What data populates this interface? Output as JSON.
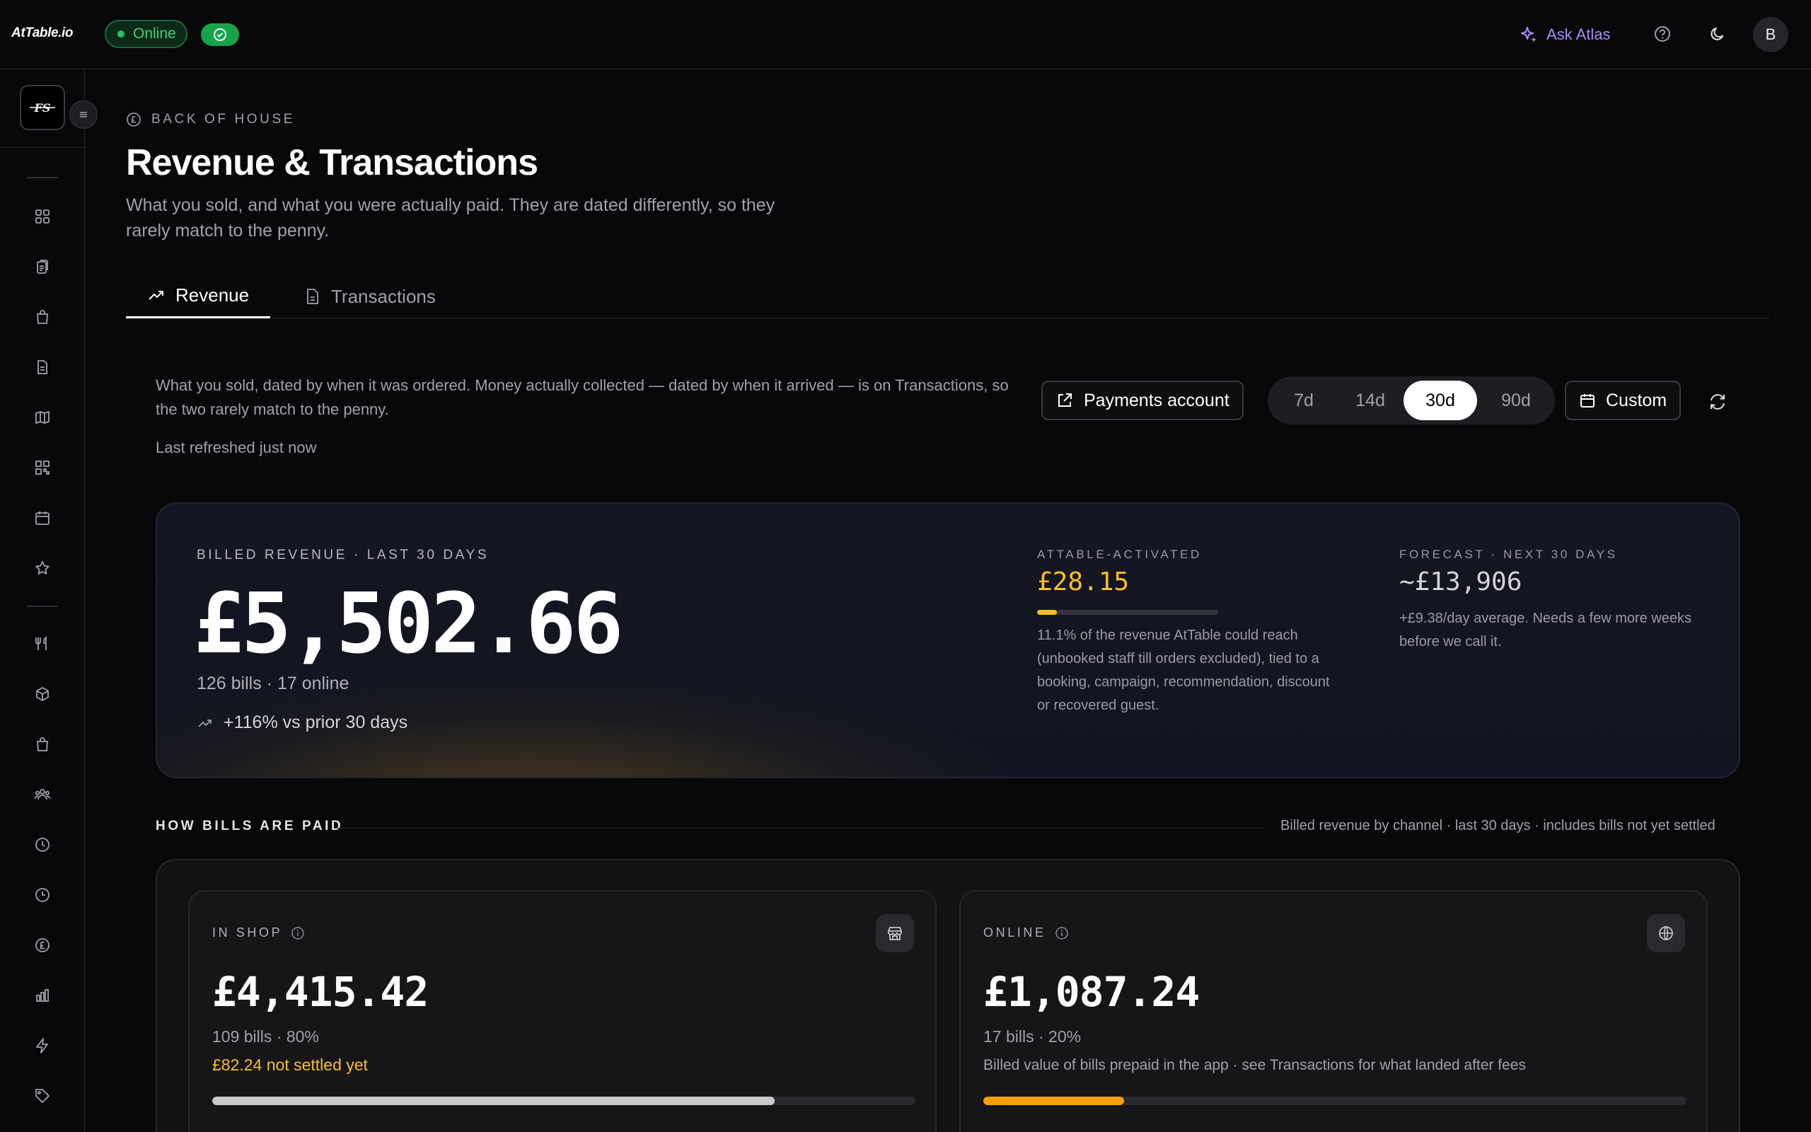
{
  "topbar": {
    "logo": "AtTable.io",
    "status": "Online",
    "ask_label": "Ask Atlas",
    "avatar_initial": "B"
  },
  "sidebar": {
    "brand_mark": "FS",
    "items": [
      "grid-icon",
      "clipboard-icon",
      "bag-icon",
      "document-icon",
      "map-icon",
      "qr-icon",
      "calendar-icon",
      "star-icon",
      "utensils-icon",
      "box-icon",
      "bag-icon",
      "users-icon",
      "clock-icon",
      "clock-icon",
      "pound-icon",
      "bar-chart-icon",
      "lightning-icon",
      "tag-icon"
    ]
  },
  "header": {
    "eyebrow": "Back of house",
    "title": "Revenue & Transactions",
    "description": "What you sold, and what you were actually paid. They are dated differently, so they rarely match to the penny."
  },
  "tabs": [
    {
      "label": "Revenue",
      "active": true
    },
    {
      "label": "Transactions",
      "active": false
    }
  ],
  "controls": {
    "intro": "What you sold, dated by when it was ordered. Money actually collected — dated by when it arrived — is on Transactions, so the two rarely match to the penny.",
    "last_refreshed": "Last refreshed just now",
    "payments_account": "Payments account",
    "ranges": [
      "7d",
      "14d",
      "30d",
      "90d"
    ],
    "active_range": "30d",
    "custom": "Custom"
  },
  "hero": {
    "label": "Billed revenue · last 30 days",
    "amount": "£5,502.66",
    "bills": "126 bills · 17 online",
    "trend": "+116% vs prior 30 days",
    "activated_label": "AtTable-activated",
    "activated_amount": "£28.15",
    "activated_fraction": 0.111,
    "activated_text": "11.1% of the revenue AtTable could reach (unbooked staff till orders excluded), tied to a booking, campaign, recommendation, discount or recovered guest.",
    "forecast_label": "Forecast · next 30 days",
    "forecast_amount": "~£13,906",
    "forecast_text": "+£9.38/day average. Needs a few more weeks before we call it."
  },
  "bills_section": {
    "title": "How bills are paid",
    "note": "Billed revenue by channel · last 30 days · includes bills not yet settled",
    "in_shop": {
      "label": "In shop",
      "amount": "£4,415.42",
      "sub": "109 bills · 80%",
      "warning": "£82.24 not settled yet",
      "share": 0.8,
      "bar_color": "#c9c9cc"
    },
    "online": {
      "label": "Online",
      "amount": "£1,087.24",
      "sub": "17 bills · 20%",
      "note": "Billed value of bills prepaid in the app · see Transactions for what landed after fees",
      "share": 0.2,
      "bar_color": "#f59e0b"
    }
  },
  "colors": {
    "accent_green": "#22c55e",
    "accent_amber": "#fbbf24",
    "accent_purple": "#a78bfa"
  }
}
